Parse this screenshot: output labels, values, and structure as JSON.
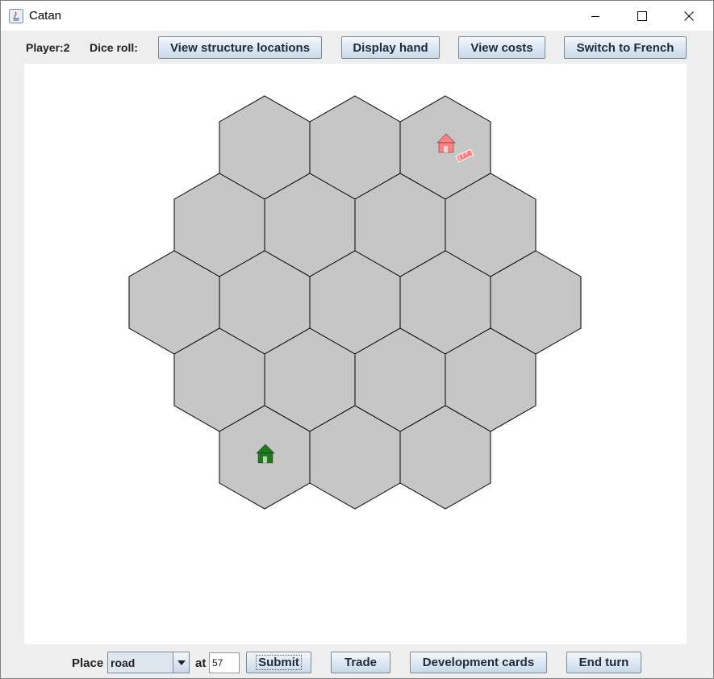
{
  "window": {
    "title": "Catan"
  },
  "toolbar": {
    "player_label": "Player:2",
    "dice_label": "Dice roll:",
    "view_structures": "View structure locations",
    "display_hand": "Display hand",
    "view_costs": "View costs",
    "switch_language": "Switch to French"
  },
  "board": {
    "hex_fill": "#c6c6c6",
    "hex_stroke": "#000000",
    "rows": [
      3,
      4,
      5,
      4,
      3
    ],
    "pieces": [
      {
        "kind": "settlement",
        "color": "#ff8080",
        "player": "red"
      },
      {
        "kind": "road",
        "color": "#ff8080",
        "player": "red"
      },
      {
        "kind": "settlement",
        "color": "#1f7a1f",
        "player": "green"
      }
    ]
  },
  "controls": {
    "place_label": "Place",
    "place_selected": "road",
    "at_label": "at",
    "location_value": "57",
    "submit": "Submit",
    "trade": "Trade",
    "development_cards": "Development cards",
    "end_turn": "End turn"
  }
}
